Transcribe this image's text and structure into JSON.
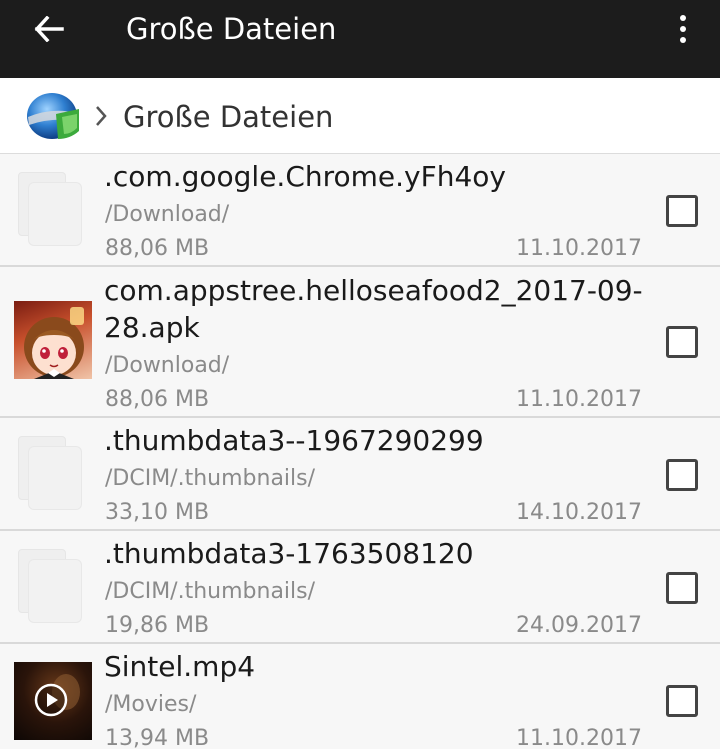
{
  "appbar": {
    "title": "Große Dateien"
  },
  "breadcrumb": {
    "label": "Große Dateien"
  },
  "files": [
    {
      "name": ".com.google.Chrome.yFh4oy",
      "path": "/Download/",
      "size": "88,06 MB",
      "date": "11.10.2017",
      "icon": "generic-file-icon"
    },
    {
      "name": "com.appstree.helloseafood2_2017-09-28.apk",
      "path": "/Download/",
      "size": "88,06 MB",
      "date": "11.10.2017",
      "icon": "app-thumbnail"
    },
    {
      "name": ".thumbdata3--1967290299",
      "path": "/DCIM/.thumbnails/",
      "size": "33,10 MB",
      "date": "14.10.2017",
      "icon": "generic-file-icon"
    },
    {
      "name": ".thumbdata3-1763508120",
      "path": "/DCIM/.thumbnails/",
      "size": "19,86 MB",
      "date": "24.09.2017",
      "icon": "generic-file-icon"
    },
    {
      "name": "Sintel.mp4",
      "path": "/Movies/",
      "size": "13,94 MB",
      "date": "11.10.2017",
      "icon": "video-thumbnail"
    }
  ]
}
